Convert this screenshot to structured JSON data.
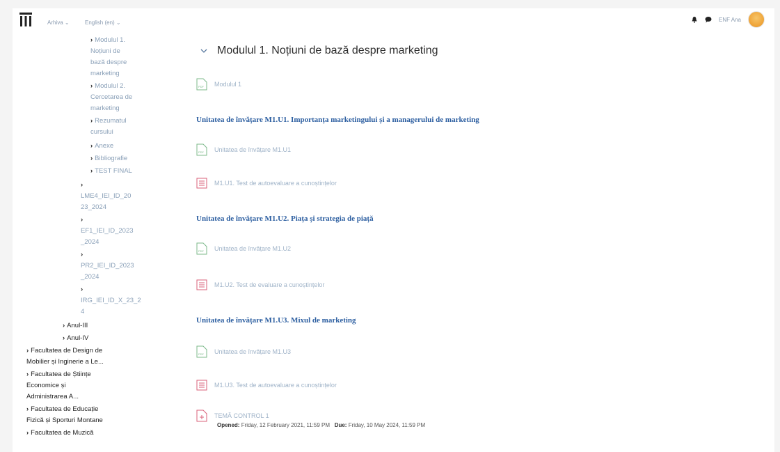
{
  "topbar": {
    "menu": [
      "Arhiva ⌄",
      "English (en) ⌄"
    ],
    "user": "ENF Ana"
  },
  "sidebar": {
    "items": [
      {
        "label": "Modulul 1."
      },
      {
        "label": "Noțiuni de"
      },
      {
        "label": "bază despre"
      },
      {
        "label": "marketing"
      },
      {
        "label": "Modulul 2."
      },
      {
        "label": "Cercetarea de"
      },
      {
        "label": "marketing"
      },
      {
        "label": "Rezumatul"
      },
      {
        "label": "cursului"
      },
      {
        "label": "Anexe"
      },
      {
        "label": "Bibliografie"
      },
      {
        "label": "TEST FINAL"
      },
      {
        "label": "LME4_IEI_ID_20"
      },
      {
        "label": "23_2024"
      },
      {
        "label": "EF1_IEI_ID_2023"
      },
      {
        "label": "_2024"
      },
      {
        "label": "PR2_IEI_ID_2023"
      },
      {
        "label": "_2024"
      },
      {
        "label": "IRG_IEI_ID_X_23_2"
      },
      {
        "label": "4"
      },
      {
        "label": "Anul-III"
      },
      {
        "label": "Anul-IV"
      },
      {
        "label": "Facultatea de Design de"
      },
      {
        "label": "Mobilier și Inginerie a Le..."
      },
      {
        "label": "Facultatea de Științe"
      },
      {
        "label": "Economice și"
      },
      {
        "label": "Administrarea A..."
      },
      {
        "label": "Facultatea de Educație"
      },
      {
        "label": "Fizică și Sporturi Montane"
      },
      {
        "label": "Facultatea de Muzică"
      }
    ]
  },
  "main": {
    "module_title": "Modulul 1. Noțiuni de bază despre marketing",
    "module_file": "Modulul 1",
    "units": [
      {
        "heading": "Unitatea de învățare M1.U1. Importanța marketingului și a managerului de marketing",
        "file": "Unitatea de învățare M1.U1",
        "quiz": "M1.U1. Test de autoevaluare a cunoștințelor"
      },
      {
        "heading": "Unitatea de învățare M1.U2. Piața și strategia de piață",
        "file": "Unitatea de învățare M1.U2",
        "quiz": "M1.U2. Test de evaluare a cunoștințelor"
      },
      {
        "heading": "Unitatea de învățare M1.U3. Mixul de marketing",
        "file": "Unitatea de învățare M1.U3",
        "quiz": "M1.U3. Test de autoevaluare a cunoștințelor"
      }
    ],
    "assignment": {
      "label": "TEMĂ CONTROL 1",
      "opened_label": "Opened:",
      "opened": "Friday, 12 February 2021, 11:59 PM",
      "due_label": "Due:",
      "due": "Friday, 10 May 2024, 11:59 PM"
    }
  }
}
